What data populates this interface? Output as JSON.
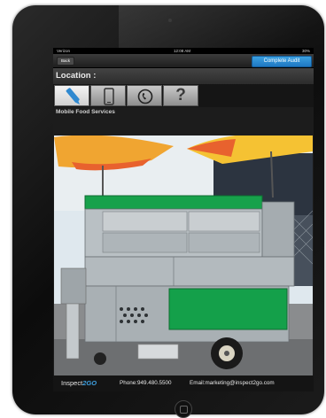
{
  "status_bar": {
    "carrier": "Verizon",
    "time": "12:08 AM",
    "battery": "30%"
  },
  "nav": {
    "back_label": "Back",
    "complete_audit_label": "Complete Audit"
  },
  "location_label": "Location :",
  "tabs": [
    {
      "icon": "pencil-icon",
      "selected": true
    },
    {
      "icon": "phone-device-icon",
      "selected": false
    },
    {
      "icon": "telephone-icon",
      "selected": false
    },
    {
      "icon": "question-mark-icon",
      "label": "?",
      "selected": false
    }
  ],
  "company_name": "Mobile Food Services",
  "footer": {
    "brand_prefix": "Inspect",
    "brand_suffix": "2GO",
    "phone": "Phone:949.480.5500",
    "email": "Email:marketing@inspect2go.com"
  },
  "colors": {
    "accent": "#2a8bd2",
    "cart_green": "#14a04a",
    "sky": "#dfe8ee"
  }
}
